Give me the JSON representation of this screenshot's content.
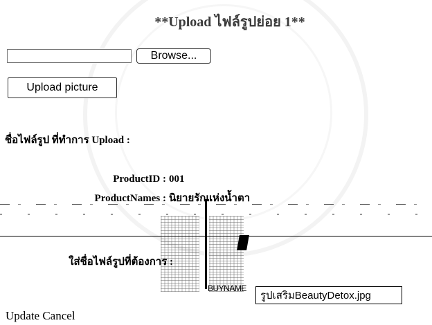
{
  "page": {
    "title": "**Upload ไฟล์รูปย่อย 1**"
  },
  "upload": {
    "file_value": "",
    "browse_label": "Browse...",
    "upload_label": "Upload picture"
  },
  "uploaded_heading": "ชื่อไฟล์รูป ที่ทำการ Upload :",
  "product": {
    "id_label": "ProductID :",
    "id_value": "001",
    "names_label": "ProductNames :",
    "names_value": "นิยายรักแห่งน้ำตา"
  },
  "rename": {
    "label": "ใส่ชื่อไฟล์รูปที่ต้องการ :",
    "value": "รูปเสริมBeautyDetox.jpg",
    "image_caption": "BUYNAME"
  },
  "actions": {
    "update_label": "Update",
    "cancel_label": "Cancel"
  }
}
